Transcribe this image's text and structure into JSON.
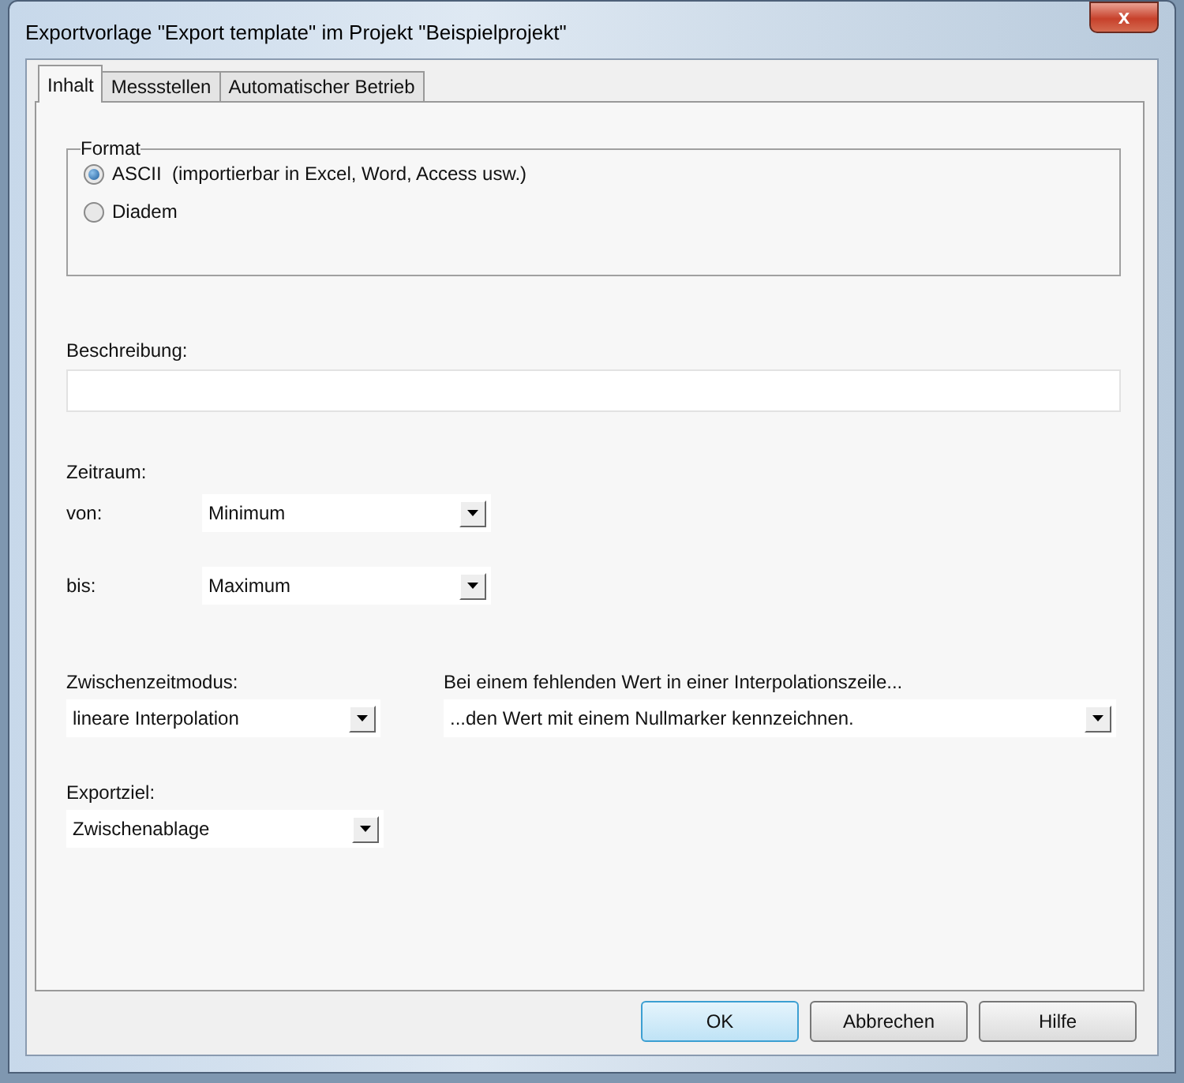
{
  "window": {
    "title": "Exportvorlage \"Export template\" im Projekt \"Beispielprojekt\"",
    "close": "x"
  },
  "tabs": [
    {
      "label": "Inhalt",
      "selected": true
    },
    {
      "label": "Messstellen",
      "selected": false
    },
    {
      "label": "Automatischer Betrieb",
      "selected": false
    }
  ],
  "format": {
    "legend": "Format",
    "options": [
      {
        "label": "ASCII  (importierbar in Excel, Word, Access usw.)",
        "selected": true
      },
      {
        "label": "Diadem",
        "selected": false
      }
    ]
  },
  "description": {
    "label": "Beschreibung:"
  },
  "period": {
    "label": "Zeitraum:",
    "from": {
      "label": "von:",
      "value": "Minimum"
    },
    "to": {
      "label": "bis:",
      "value": "Maximum"
    }
  },
  "interim_mode": {
    "label": "Zwischenzeitmodus:",
    "value": "lineare Interpolation"
  },
  "missing_value": {
    "label": "Bei einem fehlenden Wert in einer Interpolationszeile...",
    "value": "...den Wert mit einem Nullmarker kennzeichnen."
  },
  "export_target": {
    "label": "Exportziel:",
    "value": "Zwischenablage"
  },
  "buttons": [
    {
      "label": "OK",
      "default": true
    },
    {
      "label": "Abbrechen",
      "default": false
    },
    {
      "label": "Hilfe",
      "default": false
    }
  ]
}
